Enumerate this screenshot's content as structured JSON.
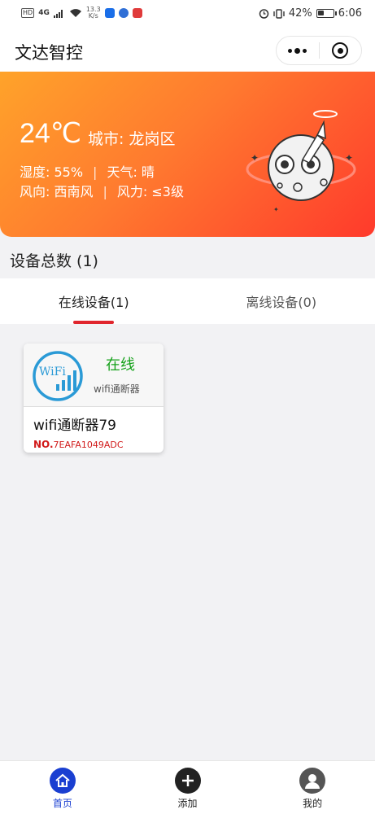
{
  "status_bar": {
    "network_badge": "HD",
    "signal_type": "4G",
    "speed_value": "13.3",
    "speed_unit": "K/s",
    "battery_percent": "42%",
    "battery_level": 0.42,
    "time": "6:06"
  },
  "header": {
    "title": "文达智控"
  },
  "weather": {
    "temperature": "24℃",
    "city": "城市: 龙岗区",
    "humidity": "湿度: 55%",
    "separator": "|",
    "condition": "天气: 晴",
    "wind_direction": "风向: 西南风",
    "wind_force": "风力: ≤3级"
  },
  "devices": {
    "total_label": "设备总数 (1)"
  },
  "tabs": [
    {
      "label": "在线设备(1)",
      "active": true
    },
    {
      "label": "离线设备(0)",
      "active": false
    }
  ],
  "device_cards": [
    {
      "logo_text": "WiFi",
      "status": "在线",
      "type": "wifi通断器",
      "name": "wifi通断器79",
      "no_prefix": "NO.",
      "no_value": "7EAFA1049ADC"
    }
  ],
  "bottom_nav": [
    {
      "label": "首页",
      "icon": "home-icon",
      "active": true
    },
    {
      "label": "添加",
      "icon": "add-icon",
      "active": false
    },
    {
      "label": "我的",
      "icon": "user-icon",
      "active": false
    }
  ],
  "colors": {
    "accent_red": "#e0262d",
    "online_green": "#15a11a",
    "nav_active_blue": "#1a3fd1",
    "banner_start": "#ffa32a",
    "banner_end": "#ff3a2c"
  }
}
